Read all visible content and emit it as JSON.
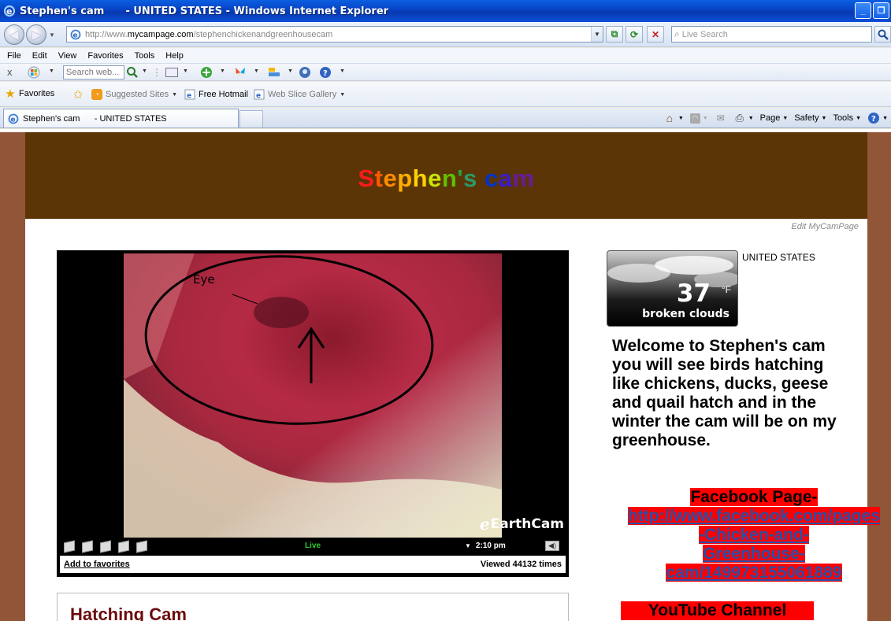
{
  "window": {
    "title": "Stephen's cam      - UNITED STATES - Windows Internet Explorer",
    "buttons": [
      "minimize",
      "restore"
    ]
  },
  "address_bar": {
    "url_prefix": "http://www.",
    "url_domain": "mycampage.com",
    "url_path": "/stephenchickenandgreenhousecam",
    "search_placeholder": "Live Search"
  },
  "menu": [
    "File",
    "Edit",
    "View",
    "Favorites",
    "Tools",
    "Help"
  ],
  "toolbar": {
    "close_x": "x",
    "search_placeholder": "Search web..."
  },
  "favorites_bar": {
    "favorites_label": "Favorites",
    "items": [
      {
        "label": "Suggested Sites",
        "icon": "suggested-sites-icon"
      },
      {
        "label": "Free Hotmail",
        "icon": "ie-page-icon"
      },
      {
        "label": "Web Slice Gallery",
        "icon": "ie-page-icon"
      }
    ]
  },
  "tabs": {
    "active_label": "Stephen's cam      - UNITED STATES"
  },
  "command_bar": {
    "page_label": "Page",
    "safety_label": "Safety",
    "tools_label": "Tools"
  },
  "page": {
    "site_title_letters": [
      {
        "ch": "S",
        "color": "#ff1a1a"
      },
      {
        "ch": "t",
        "color": "#ff5a00"
      },
      {
        "ch": "e",
        "color": "#ff8c00"
      },
      {
        "ch": "p",
        "color": "#ffae00"
      },
      {
        "ch": "h",
        "color": "#ffd200"
      },
      {
        "ch": "e",
        "color": "#c9e600"
      },
      {
        "ch": "n",
        "color": "#5fbf00"
      },
      {
        "ch": "'",
        "color": "#2aa33a"
      },
      {
        "ch": "s",
        "color": "#2a9a6a"
      },
      {
        "ch": " ",
        "color": "#ffffff"
      },
      {
        "ch": "c",
        "color": "#0033cc"
      },
      {
        "ch": "a",
        "color": "#3a1cc8"
      },
      {
        "ch": "m",
        "color": "#6a1b9a"
      }
    ],
    "edit_link": "Edit MyCamPage",
    "cam": {
      "annotation_text": "Eye",
      "brand": "EarthCam",
      "status": "Live",
      "time": "2:10 pm",
      "add_favorites": "Add to favorites",
      "viewed": "Viewed 44132 times"
    },
    "hatching_title": "Hatching Cam",
    "weather": {
      "temperature": "37",
      "unit": "°F",
      "condition": "broken clouds",
      "location": "UNITED STATES"
    },
    "welcome_text": "Welcome to Stephen's cam you will see birds hatching like chickens, ducks, geese and quail hatch and in the winter the cam will be on my greenhouse.",
    "facebook_label": "Facebook Page-",
    "facebook_url_lines": [
      "http://www.facebook.com/pages",
      "-Chicken-and-",
      "Greenhouse-",
      "cam/149973155061889"
    ],
    "youtube_label": "YouTube Channel"
  },
  "colors": {
    "header_bg": "#5c3507",
    "page_side_bg": "#915538",
    "highlight_red": "#ff0000",
    "link_blue": "#2a4fa8"
  }
}
